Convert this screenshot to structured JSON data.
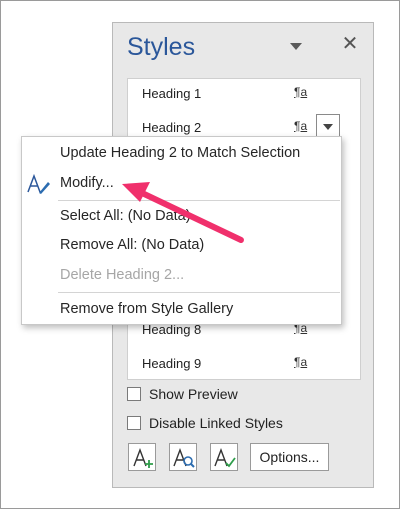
{
  "pane": {
    "title": "Styles",
    "styles": [
      {
        "label": "Heading 1",
        "mark": "¶a"
      },
      {
        "label": "Heading 2",
        "mark": "¶a"
      },
      {
        "label": "Heading 8",
        "mark": "¶a"
      },
      {
        "label": "Heading 9",
        "mark": "¶a"
      }
    ],
    "checkboxes": [
      {
        "label": "Show Preview",
        "checked": false
      },
      {
        "label": "Disable Linked Styles",
        "checked": false
      }
    ],
    "buttons": {
      "new_style_icon": "new-style-icon",
      "style_inspector_icon": "style-inspector-icon",
      "manage_styles_icon": "manage-styles-icon",
      "options_label": "Options..."
    }
  },
  "context_menu": {
    "items": [
      {
        "label": "Update Heading 2 to Match Selection",
        "enabled": true
      },
      {
        "label": "Modify...",
        "enabled": true,
        "icon": "modify-style-icon"
      },
      {
        "label": "Select All: (No Data)",
        "enabled": true
      },
      {
        "label": "Remove All: (No Data)",
        "enabled": true
      },
      {
        "label": "Delete Heading 2...",
        "enabled": false
      },
      {
        "label": "Remove from Style Gallery",
        "enabled": true
      }
    ]
  },
  "colors": {
    "title_blue": "#2b579a",
    "arrow_pink": "#f0306c",
    "pane_background": "#e8e8e8"
  }
}
